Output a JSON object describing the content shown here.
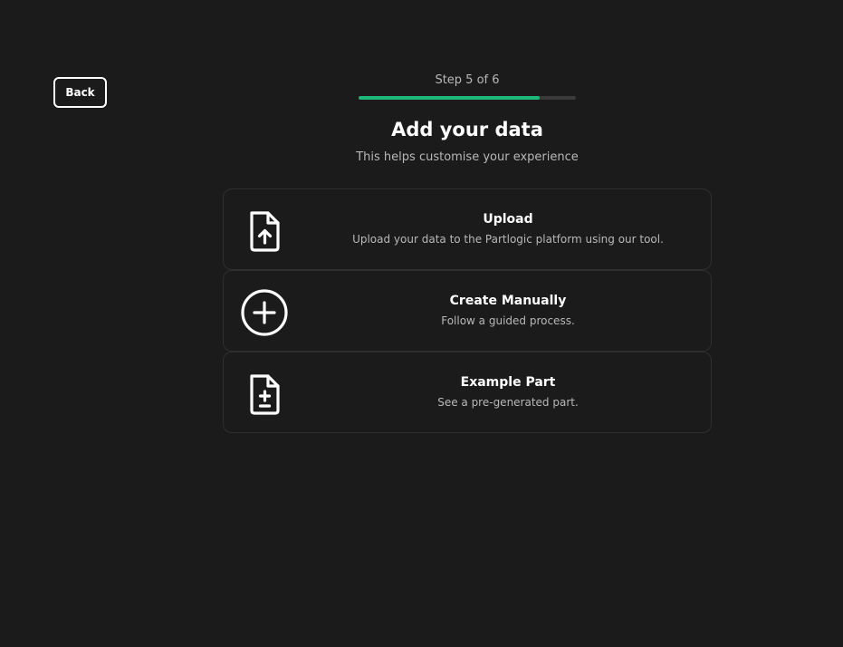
{
  "back_button": {
    "label": "Back"
  },
  "progress": {
    "label": "Step 5 of 6",
    "current_step": 5,
    "total_steps": 6,
    "fill_color": "#1db87a",
    "track_color": "#3a3a3a"
  },
  "header": {
    "title": "Add your data",
    "subtitle": "This helps customise your experience"
  },
  "options": [
    {
      "icon": "file-upload-icon",
      "title": "Upload",
      "description": "Upload your data to the Partlogic platform using our tool."
    },
    {
      "icon": "plus-circle-icon",
      "title": "Create Manually",
      "description": "Follow a guided process."
    },
    {
      "icon": "file-plus-minus-icon",
      "title": "Example Part",
      "description": "See a pre-generated part."
    }
  ]
}
